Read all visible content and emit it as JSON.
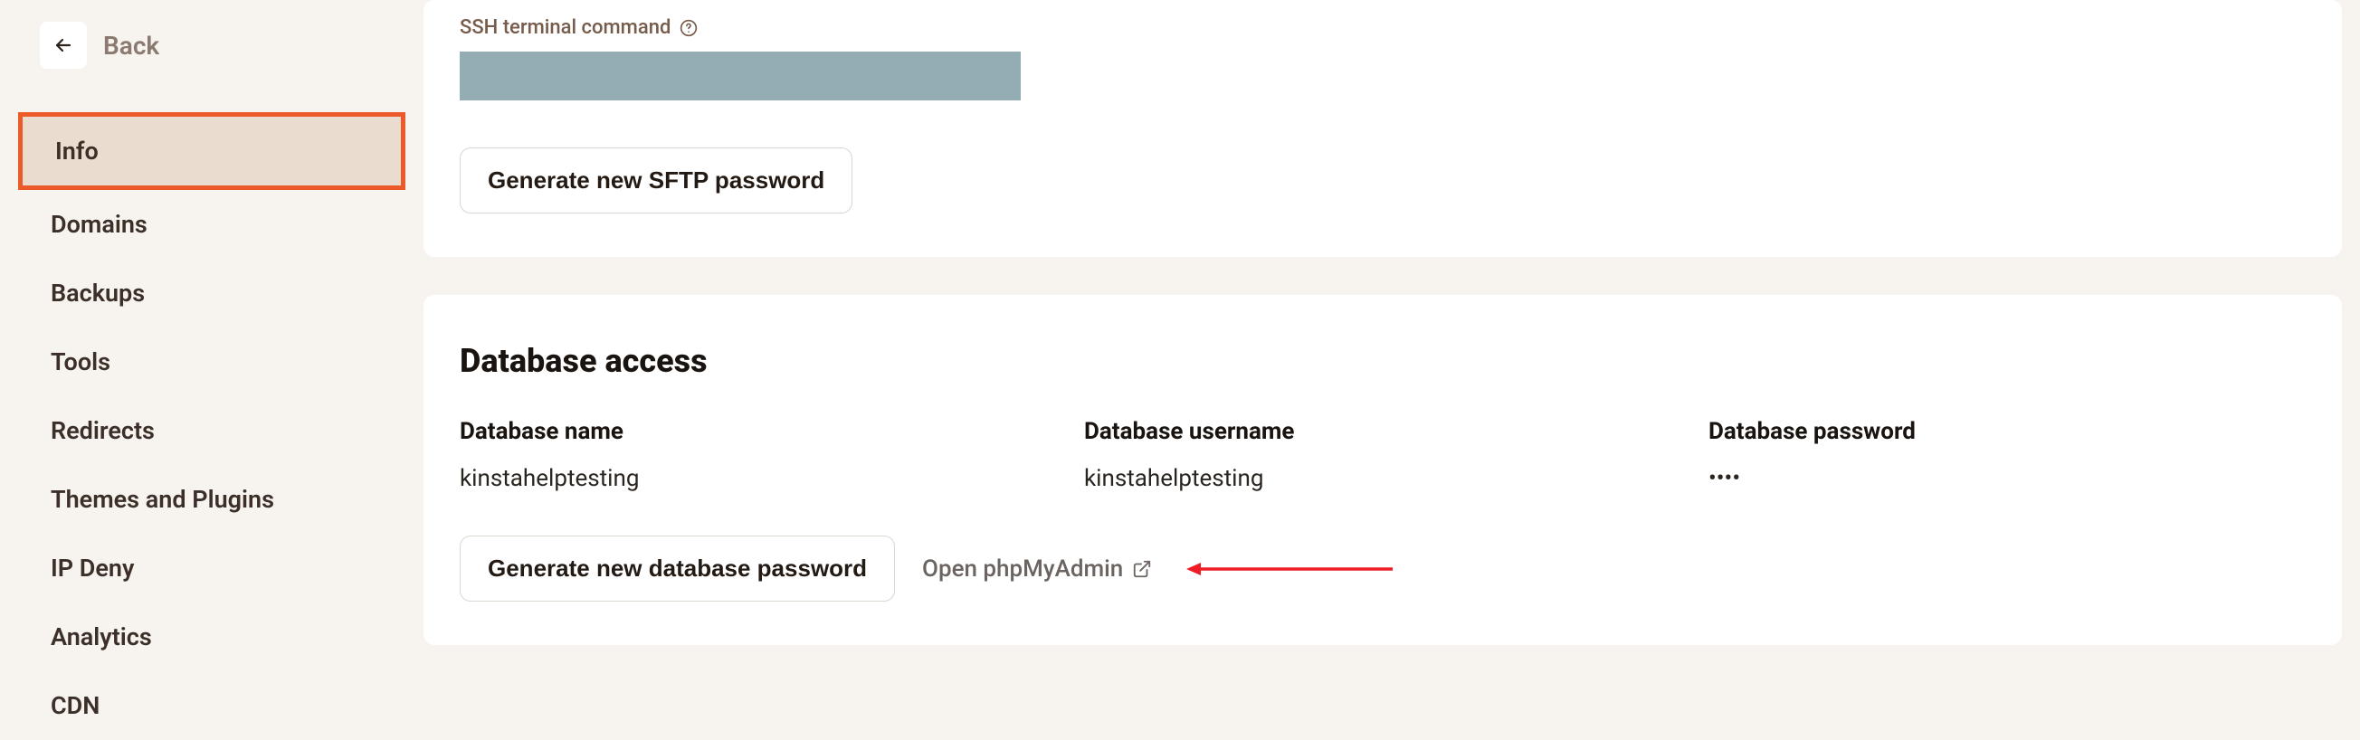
{
  "sidebar": {
    "back_label": "Back",
    "items": [
      {
        "label": "Info",
        "active": true
      },
      {
        "label": "Domains",
        "active": false
      },
      {
        "label": "Backups",
        "active": false
      },
      {
        "label": "Tools",
        "active": false
      },
      {
        "label": "Redirects",
        "active": false
      },
      {
        "label": "Themes and Plugins",
        "active": false
      },
      {
        "label": "IP Deny",
        "active": false
      },
      {
        "label": "Analytics",
        "active": false
      },
      {
        "label": "CDN",
        "active": false
      }
    ]
  },
  "ssh": {
    "label": "SSH terminal command"
  },
  "sftp": {
    "generate_button": "Generate new SFTP password"
  },
  "database": {
    "section_title": "Database access",
    "name_label": "Database name",
    "name_value": "kinstahelptesting",
    "username_label": "Database username",
    "username_value": "kinstahelptesting",
    "password_label": "Database password",
    "password_value": "••••",
    "generate_button": "Generate new database password",
    "phpmyadmin_label": "Open phpMyAdmin"
  }
}
